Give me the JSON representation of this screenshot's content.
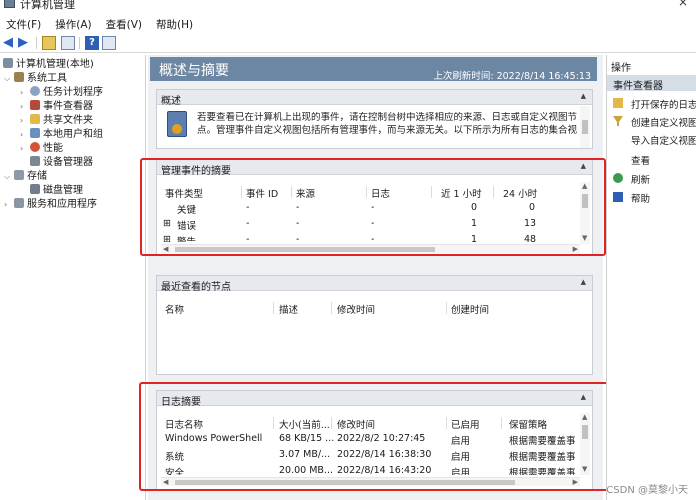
{
  "window": {
    "title": "计算机管理",
    "close_glyph": "×"
  },
  "menu": [
    "文件(F)",
    "操作(A)",
    "查看(V)",
    "帮助(H)"
  ],
  "toolbar": {
    "icons": [
      "back-arrow-icon",
      "forward-arrow-icon",
      "up-folder-icon",
      "console-tree-icon",
      "help-icon",
      "view-icon"
    ]
  },
  "tree": {
    "root": "计算机管理(本地)",
    "system_tools": "系统工具",
    "task_scheduler": "任务计划程序",
    "event_viewer": "事件查看器",
    "shared_folders": "共享文件夹",
    "local_users": "本地用户和组",
    "performance": "性能",
    "device_manager": "设备管理器",
    "storage": "存储",
    "disk_management": "磁盘管理",
    "services_apps": "服务和应用程序"
  },
  "header": {
    "title": "概述与摘要",
    "refresh": "上次刷新时间: 2022/8/14 16:45:13"
  },
  "overview": {
    "title": "概述",
    "text": "若要查看已在计算机上出现的事件，请在控制台树中选择相应的来源、日志或自定义视图节点。管理事件自定义视图包括所有管理事件，而与来源无关。以下所示为所有日志的集合视"
  },
  "admin_events": {
    "title": "管理事件的摘要",
    "columns": [
      "事件类型",
      "事件 ID",
      "来源",
      "日志",
      "近 1 小时",
      "24 小时"
    ],
    "rows": [
      {
        "type": "关键",
        "id": "-",
        "source": "-",
        "log": "-",
        "hour": "0",
        "day": "0",
        "expander": ""
      },
      {
        "type": "错误",
        "id": "-",
        "source": "-",
        "log": "-",
        "hour": "1",
        "day": "13",
        "expander": "⊞"
      },
      {
        "type": "警告",
        "id": "-",
        "source": "-",
        "log": "-",
        "hour": "1",
        "day": "48",
        "expander": "⊞"
      }
    ]
  },
  "recent_nodes": {
    "title": "最近查看的节点",
    "columns": [
      "名称",
      "描述",
      "修改时间",
      "创建时间"
    ]
  },
  "log_summary": {
    "title": "日志摘要",
    "columns": [
      "日志名称",
      "大小(当前...",
      "修改时间",
      "已启用",
      "保留策略"
    ],
    "rows": [
      {
        "name": "Windows PowerShell",
        "size": "68 KB/15 ...",
        "modified": "2022/8/2 10:27:45",
        "enabled": "启用",
        "policy": "根据需要覆盖事"
      },
      {
        "name": "系统",
        "size": "3.07 MB/...",
        "modified": "2022/8/14 16:38:30",
        "enabled": "启用",
        "policy": "根据需要覆盖事"
      },
      {
        "name": "安全",
        "size": "20.00 MB...",
        "modified": "2022/8/14 16:43:20",
        "enabled": "启用",
        "policy": "根据需要覆盖事"
      }
    ]
  },
  "actions": {
    "title": "操作",
    "section": "事件查看器",
    "items": [
      "打开保存的日志...",
      "创建自定义视图...",
      "导入自定义视图...",
      "查看",
      "刷新",
      "帮助"
    ]
  },
  "watermark": "CSDN @莫黎小天",
  "colors": {
    "header_band": "#6c87a3",
    "highlight_box": "#e02424",
    "selection": "#cce4f7"
  }
}
